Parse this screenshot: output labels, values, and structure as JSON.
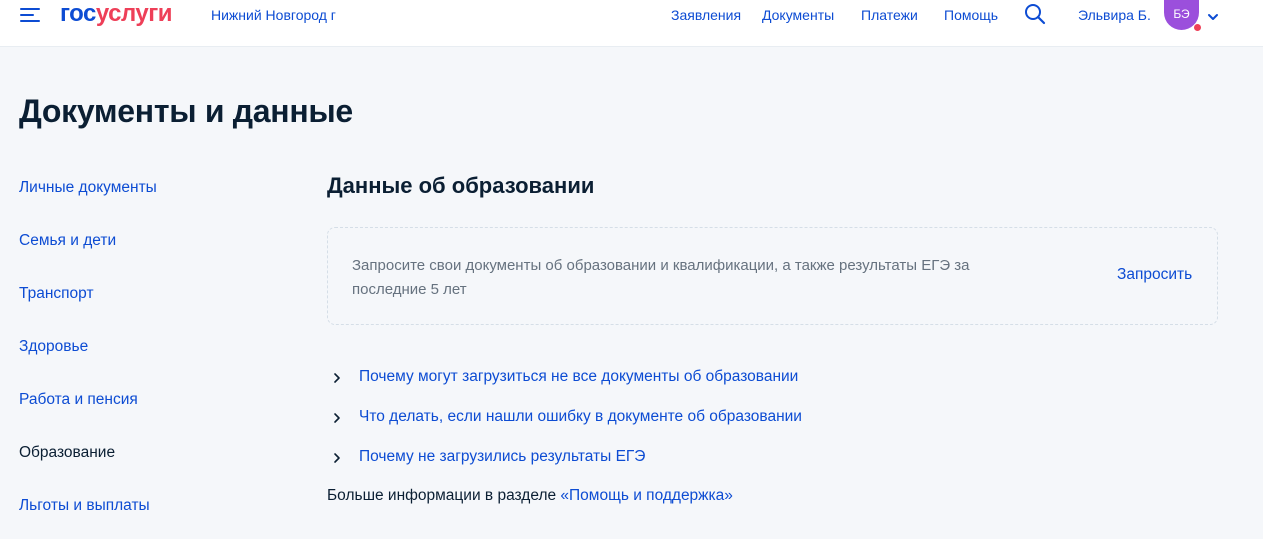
{
  "header": {
    "logo_part1": "гос",
    "logo_part2": "услуги",
    "city": "Нижний Новгород г",
    "nav": [
      "Заявления",
      "Документы",
      "Платежи",
      "Помощь"
    ],
    "user_name": "Эльвира Б.",
    "avatar_initials": "БЭ"
  },
  "page": {
    "title": "Документы и данные"
  },
  "sidebar": {
    "items": [
      {
        "label": "Личные документы"
      },
      {
        "label": "Семья и дети"
      },
      {
        "label": "Транспорт"
      },
      {
        "label": "Здоровье"
      },
      {
        "label": "Работа и пенсия"
      },
      {
        "label": "Образование"
      },
      {
        "label": "Льготы и выплаты"
      }
    ],
    "active": "Образование"
  },
  "main": {
    "section_title": "Данные об образовании",
    "card_text": "Запросите свои документы об образовании и квалификации, а также результаты ЕГЭ за последние 5 лет",
    "card_action": "Запросить",
    "faq": [
      "Почему могут загрузиться не все документы об образовании",
      "Что делать, если нашли ошибку в документе об образовании",
      "Почему не загрузились результаты ЕГЭ"
    ],
    "more_prefix": "Больше информации в разделе ",
    "more_link": "«Помощь и поддержка»"
  },
  "colors": {
    "accent": "#0d4cd3",
    "brand_red": "#ee3f58",
    "text": "#0b1f33",
    "muted": "#66727f",
    "avatar": "#9b4fdc",
    "background": "#f5f7fa"
  },
  "icons": [
    "menu-icon",
    "search-icon",
    "chevron-down-icon",
    "chevron-right-icon"
  ]
}
